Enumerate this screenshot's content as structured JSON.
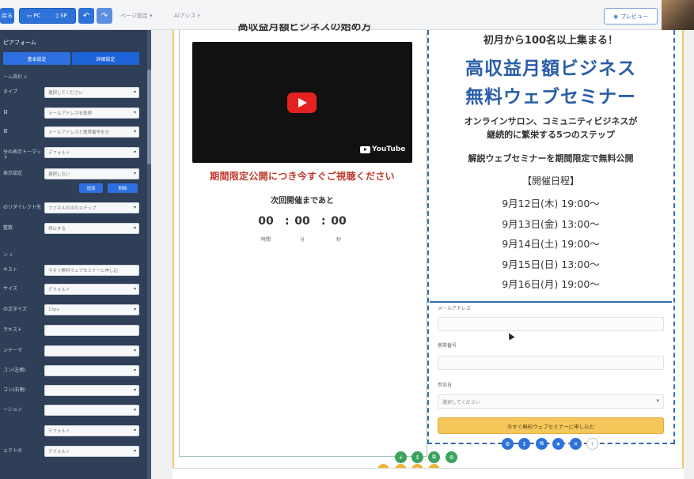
{
  "toolbar": {
    "back_label": "戻る",
    "pc_label": "PC",
    "sp_label": "SP",
    "menu1": "ページ設定 ▾",
    "menu2": "AIアシスト",
    "preview_label": "プレビュー"
  },
  "sidebar": {
    "title": "ピアフォーム",
    "tabs": [
      "基本設定",
      "詳細設定"
    ],
    "section1": "ーム選択 ∨",
    "section2": "ン ∨",
    "rows1": [
      {
        "label": "タイプ",
        "value": "選択してください"
      },
      {
        "label": "目",
        "value": "メールアドレスを取得"
      },
      {
        "label": "目",
        "value": "メールアドレスと携帯番号を分"
      },
      {
        "label": "分の表示トーマット",
        "value": "デフォルト"
      },
      {
        "label": "表示設定",
        "value": "選択しない"
      },
      {
        "label": "のリダイレクト先",
        "value": "ファネルの次のステップ"
      },
      {
        "label": "整数",
        "value": "停止する"
      }
    ],
    "mini_buttons": [
      "追加",
      "削除"
    ],
    "rows2": [
      {
        "label": "キスト",
        "value": "今すぐ無料ウェブセミナーに申し込"
      },
      {
        "label": "サイズ",
        "value": "デフォルト"
      },
      {
        "label": "の文字イズ",
        "value": "13px"
      },
      {
        "label": "ラキスト",
        "value": ""
      },
      {
        "label": "ンテーマ",
        "value": ""
      },
      {
        "label": "コン(左側)",
        "value": ""
      },
      {
        "label": "コン(右側)",
        "value": ""
      },
      {
        "label": "ーション",
        "value": ""
      },
      {
        "label": "",
        "value": "デフォルト"
      },
      {
        "label": "ェクトの",
        "value": "デフォルト"
      }
    ]
  },
  "left": {
    "clipped_title": "高収益月額ビジネスの始め方",
    "video_brand": "YouTube",
    "limited_notice": "期間限定公開につき今すぐご視聴ください",
    "next_label": "次回開催まであと",
    "countdown": [
      "00",
      "00",
      "00"
    ],
    "units": [
      "時間",
      "分",
      "秒"
    ]
  },
  "right": {
    "top": "初月から100名以上集まる！",
    "title1": "高収益月額ビジネス",
    "title2": "無料ウェブセミナー",
    "sub1": "オンラインサロン、コミュニティビジネスが",
    "sub2": "継続的に繁栄する5つのステップ",
    "sub3": "解説ウェブセミナーを期間限定で無料公開",
    "schedule_head": "【開催日程】",
    "schedule": [
      "9月12日(木) 19:00〜",
      "9月13日(金) 13:00〜",
      "9月14日(土) 19:00〜",
      "9月15日(日) 13:00〜",
      "9月16日(月) 19:00〜"
    ]
  },
  "form": {
    "email_label": "メールアドレス",
    "phone_label": "携帯番号",
    "date_label": "参加日",
    "date_placeholder": "選択してください",
    "submit": "今すぐ無料ウェブセミナーに申し込む"
  },
  "help_icon": "?"
}
